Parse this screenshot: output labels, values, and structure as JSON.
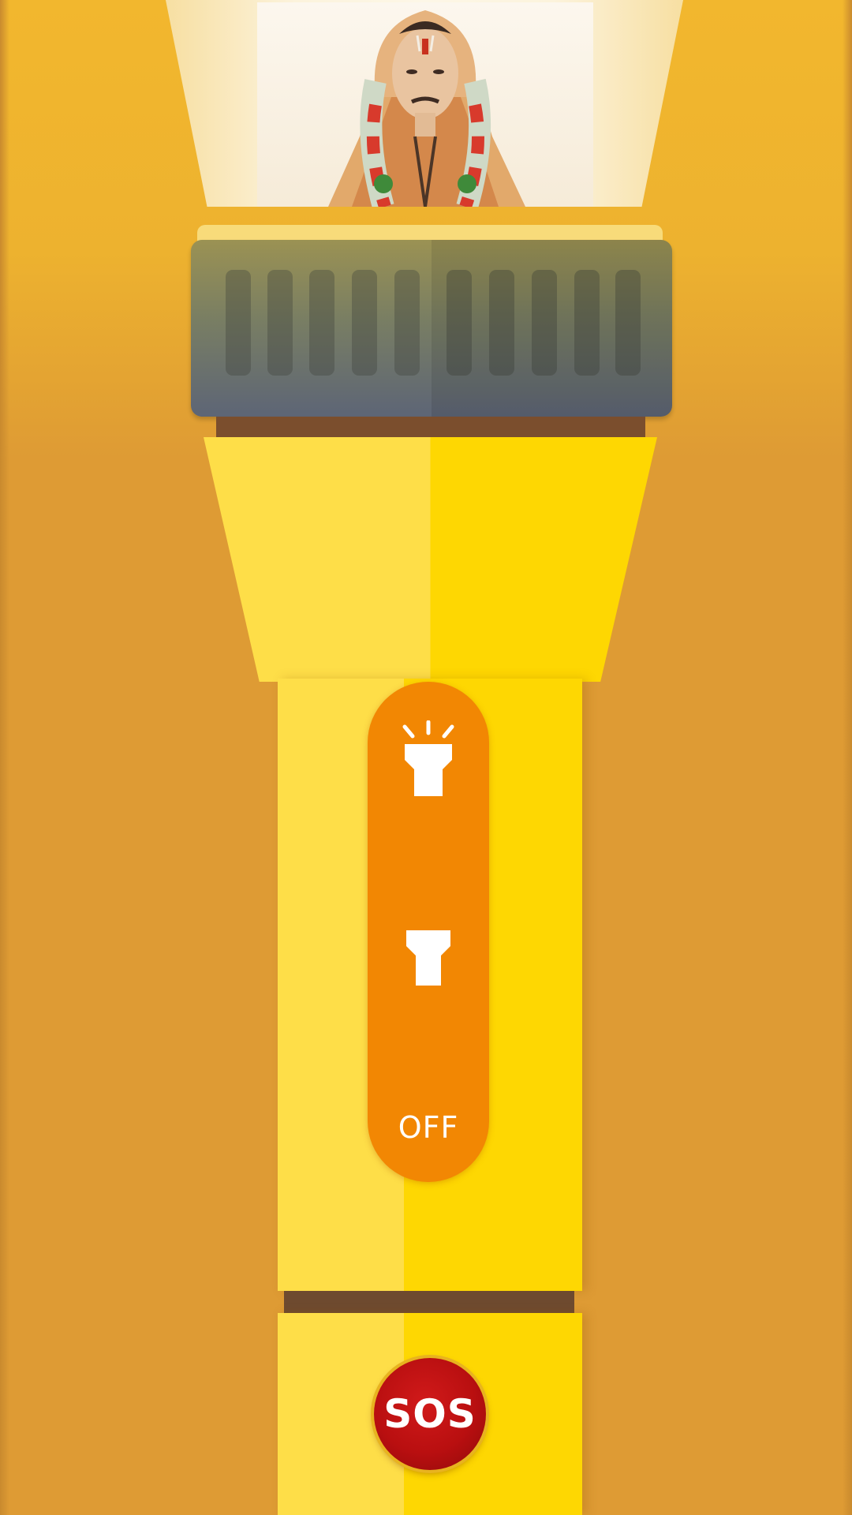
{
  "app": {
    "controls": {
      "off_label": "OFF",
      "sos_label": "SOS"
    },
    "icons": {
      "bright": "flashlight-beam-icon",
      "dim": "flashlight-icon"
    },
    "colors": {
      "background": "#DE9B34",
      "body_light": "#FEDE48",
      "body_dark": "#FED702",
      "switch_track": "#F28703",
      "sos": "#B90F10"
    }
  }
}
